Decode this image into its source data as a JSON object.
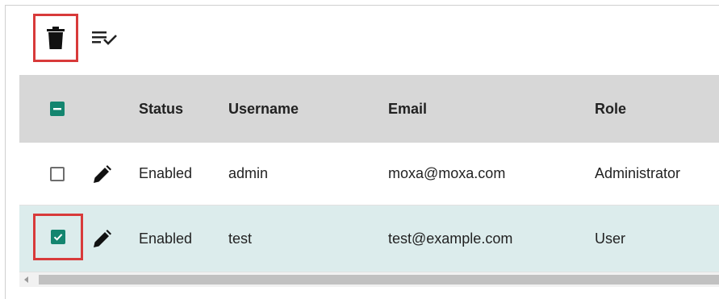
{
  "toolbar": {
    "delete_icon": "trash-icon",
    "select_all_icon": "playlist-check-icon"
  },
  "table": {
    "columns": [
      "Status",
      "Username",
      "Email",
      "Role"
    ],
    "header_checkbox_state": "indeterminate",
    "rows": [
      {
        "selected": false,
        "status": "Enabled",
        "username": "admin",
        "email": "moxa@moxa.com",
        "role": "Administrator"
      },
      {
        "selected": true,
        "status": "Enabled",
        "username": "test",
        "email": "test@example.com",
        "role": "User"
      }
    ]
  },
  "colors": {
    "accent": "#14856f",
    "header_bg": "#d7d7d7",
    "selected_row_bg": "#dcecec",
    "highlight": "#d83a3a"
  }
}
